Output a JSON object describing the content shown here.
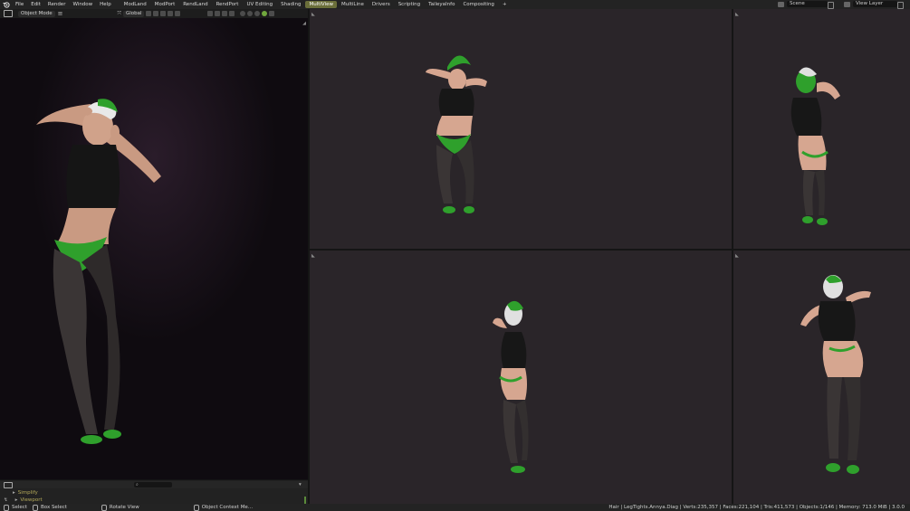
{
  "menus": [
    "File",
    "Edit",
    "Render",
    "Window",
    "Help"
  ],
  "workspaces": [
    "ModLand",
    "ModPort",
    "RendLand",
    "RendPort",
    "UV Editing",
    "Shading",
    "MultiView",
    "MultiLine",
    "Drivers",
    "Scripting",
    "TaileyaInfo",
    "Compositing"
  ],
  "active_workspace": "MultiView",
  "add_tab": "+",
  "scene": {
    "label": "Scene"
  },
  "view_layer": {
    "label": "View Layer"
  },
  "viewport": {
    "mode": "Object Mode",
    "transform": "Global"
  },
  "timeline": {
    "search_placeholder": "",
    "row1": "Simplify",
    "row2": "Viewport"
  },
  "status": {
    "select": "Select",
    "box_select": "Box Select",
    "rotate_view": "Rotate View",
    "context_menu": "Object Context Me...",
    "info": "Hair | LegTights.Annya.Diag | Verts:235,357 | Faces:221,104 | Tris:411,573 | Objects:1/146 | Memory: 713.0 MiB | 3.0.0"
  },
  "colors": {
    "accent": "#6b6f3a",
    "viewport_bg": "#2a2529",
    "render_bg": "#0f0b10",
    "character_green": "#2fa02c"
  }
}
